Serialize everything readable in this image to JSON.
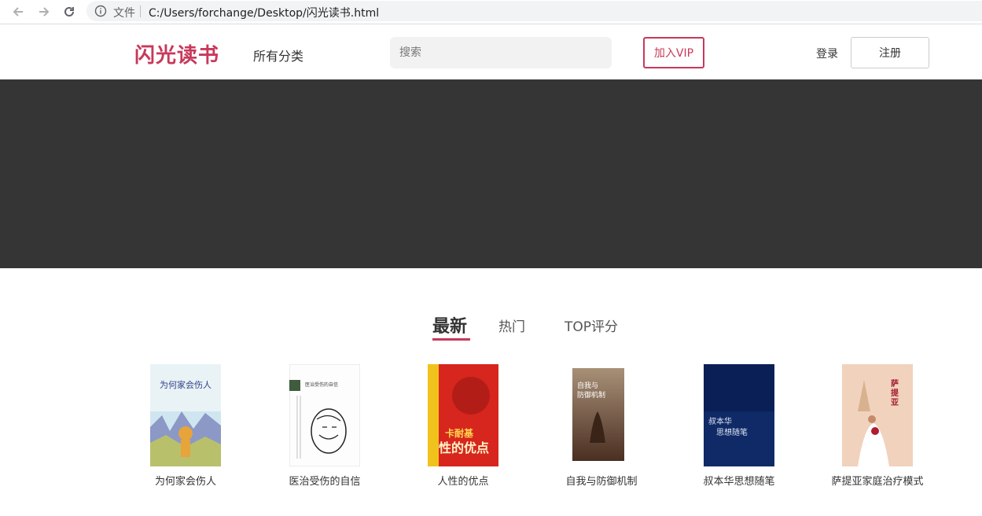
{
  "browser": {
    "scheme_label": "文件",
    "url": "C:/Users/forchange/Desktop/闪光读书.html"
  },
  "header": {
    "logo": "闪光读书",
    "categories_label": "所有分类",
    "search_placeholder": "搜索",
    "vip_label": "加入VIP",
    "login_label": "登录",
    "register_label": "注册"
  },
  "tabs": [
    {
      "label": "最新",
      "active": true
    },
    {
      "label": "热门",
      "active": false
    },
    {
      "label": "TOP评分",
      "active": false
    }
  ],
  "books": [
    {
      "title": "为何家会伤人",
      "cover_text": "为何家会伤人"
    },
    {
      "title": "医治受伤的自信",
      "cover_text": "医治受伤的自信"
    },
    {
      "title": "人性的优点",
      "cover_text": "卡耐基 人性的优点"
    },
    {
      "title": "自我与防御机制",
      "cover_text": "自我与防御机制"
    },
    {
      "title": "叔本华思想随笔",
      "cover_text": "叔本华思想随笔"
    },
    {
      "title": "萨提亚家庭治疗模式",
      "cover_text": "萨提亚家庭治疗模式"
    }
  ],
  "colors": {
    "accent": "#c8385a",
    "banner": "#353535"
  }
}
